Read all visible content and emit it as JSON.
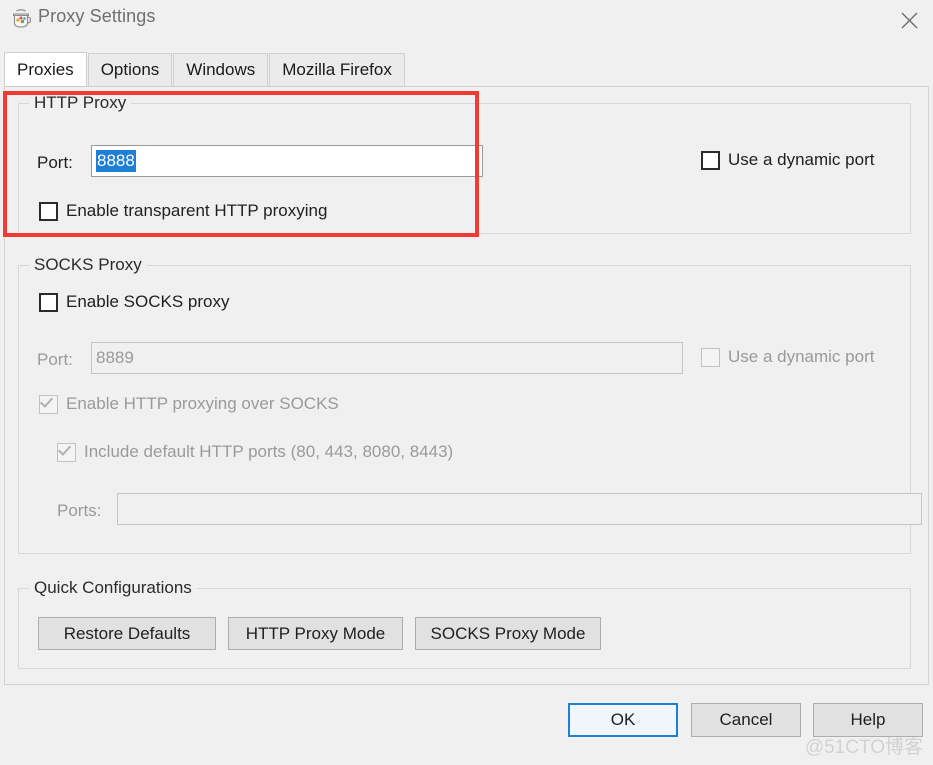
{
  "window": {
    "title": "Proxy Settings",
    "icon": "burp-jug-icon",
    "close_icon": "close-icon",
    "background_color": "#f0f0f0"
  },
  "tabs": [
    {
      "label": "Proxies",
      "selected": true
    },
    {
      "label": "Options",
      "selected": false
    },
    {
      "label": "Windows",
      "selected": false
    },
    {
      "label": "Mozilla Firefox",
      "selected": false
    }
  ],
  "http_proxy": {
    "group_title": "HTTP Proxy",
    "port_label": "Port:",
    "port_value": "8888",
    "port_value_selected": true,
    "dynamic_port_label": "Use a dynamic port",
    "dynamic_port_checked": false,
    "transparent_label": "Enable transparent HTTP proxying",
    "transparent_checked": false,
    "highlight_color": "#f23c33",
    "selection_color": "#1f7fd4"
  },
  "socks_proxy": {
    "group_title": "SOCKS Proxy",
    "enable_label": "Enable SOCKS proxy",
    "enable_checked": false,
    "port_label": "Port:",
    "port_value": "8889",
    "port_disabled": true,
    "dynamic_port_label": "Use a dynamic port",
    "dynamic_port_checked": false,
    "http_over_socks_label": "Enable HTTP proxying over SOCKS",
    "http_over_socks_checked": true,
    "http_over_socks_disabled": true,
    "include_default_ports_label": "Include default HTTP ports (80, 443, 8080, 8443)",
    "include_default_ports_checked": true,
    "include_default_ports_disabled": true,
    "ports_label": "Ports:",
    "ports_value": ""
  },
  "quick_configurations": {
    "group_title": "Quick Configurations",
    "buttons": [
      {
        "label": "Restore Defaults"
      },
      {
        "label": "HTTP Proxy Mode"
      },
      {
        "label": "SOCKS Proxy Mode"
      }
    ]
  },
  "dialog_buttons": {
    "ok": "OK",
    "cancel": "Cancel",
    "help": "Help",
    "default_button": "OK"
  },
  "watermark": "@51CTO博客"
}
